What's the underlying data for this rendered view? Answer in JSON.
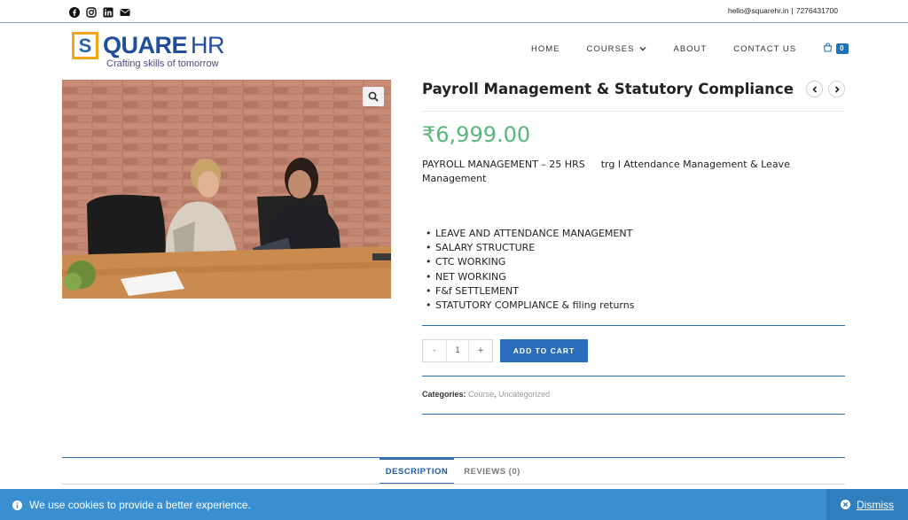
{
  "topbar": {
    "social_icons": [
      "facebook-icon",
      "instagram-icon",
      "linkedin-icon",
      "envelope-icon"
    ],
    "email": "hello@squarehr.in",
    "separator": "|",
    "phone": "7276431700"
  },
  "logo": {
    "s_letter": "S",
    "main": "QUARE",
    "hr": "HR",
    "tagline": "Crafting skills of tomorrow",
    "accent_color": "#f2a51a",
    "brand_color": "#1f4e9c"
  },
  "nav": {
    "home": "HOME",
    "courses": "COURSES",
    "about": "ABOUT",
    "contact": "CONTACT US",
    "cart_count": "0"
  },
  "product": {
    "title": "Payroll Management & Statutory Compliance",
    "price": "₹6,999.00",
    "price_color": "#57b77a",
    "description_part1": "PAYROLL MANAGEMENT – 25 HRS",
    "description_part2": "trg l Attendance Management & Leave Management",
    "bullets": [
      "LEAVE AND ATTENDANCE MANAGEMENT",
      "SALARY STRUCTURE",
      "CTC WORKING",
      "NET WORKING",
      "F&f  SETTLEMENT",
      "STATUTORY COMPLIANCE &  filing returns"
    ],
    "qty_minus": "-",
    "qty_value": "1",
    "qty_plus": "+",
    "add_to_cart": "ADD TO CART",
    "categories_label": "Categories:",
    "categories": [
      "Course",
      "Uncategorized"
    ],
    "categories_sep": ","
  },
  "tabs": {
    "description": "DESCRIPTION",
    "reviews": "REVIEWS (0)"
  },
  "cookie": {
    "message": "We use cookies to provide a better experience.",
    "dismiss": "Dismiss",
    "bar_color": "#3a8fd1"
  }
}
